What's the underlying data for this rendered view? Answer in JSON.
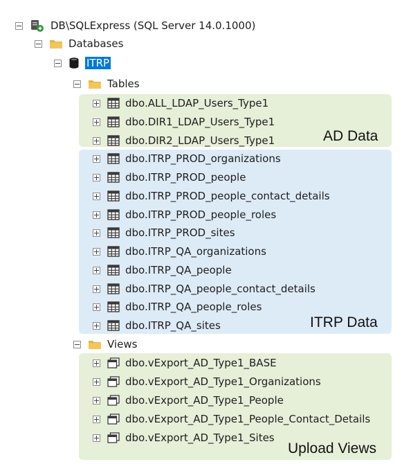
{
  "server": {
    "label": "DB\\SQLExpress (SQL Server 14.0.1000)",
    "icon": "server-icon"
  },
  "databases_folder": {
    "label": "Databases",
    "icon": "folder-icon"
  },
  "database": {
    "label": "ITRP",
    "icon": "database-icon",
    "selected": true
  },
  "tables_folder": {
    "label": "Tables",
    "icon": "folder-icon"
  },
  "views_folder": {
    "label": "Views",
    "icon": "folder-icon"
  },
  "tables": [
    "dbo.ALL_LDAP_Users_Type1",
    "dbo.DIR1_LDAP_Users_Type1",
    "dbo.DIR2_LDAP_Users_Type1",
    "dbo.ITRP_PROD_organizations",
    "dbo.ITRP_PROD_people",
    "dbo.ITRP_PROD_people_contact_details",
    "dbo.ITRP_PROD_people_roles",
    "dbo.ITRP_PROD_sites",
    "dbo.ITRP_QA_organizations",
    "dbo.ITRP_QA_people",
    "dbo.ITRP_QA_people_contact_details",
    "dbo.ITRP_QA_people_roles",
    "dbo.ITRP_QA_sites"
  ],
  "views": [
    "dbo.vExport_AD_Type1_BASE",
    "dbo.vExport_AD_Type1_Organizations",
    "dbo.vExport_AD_Type1_People",
    "dbo.vExport_AD_Type1_People_Contact_Details",
    "dbo.vExport_AD_Type1_Sites"
  ],
  "annotations": {
    "ad_data": "AD Data",
    "itrp_data": "ITRP Data",
    "upload_views": "Upload Views"
  },
  "colors": {
    "ad_group": "#e6efd8",
    "itrp_group": "#ddebf7",
    "upload_group": "#e6efd8",
    "selection": "#0078d7",
    "folder": "#e8b33a"
  }
}
